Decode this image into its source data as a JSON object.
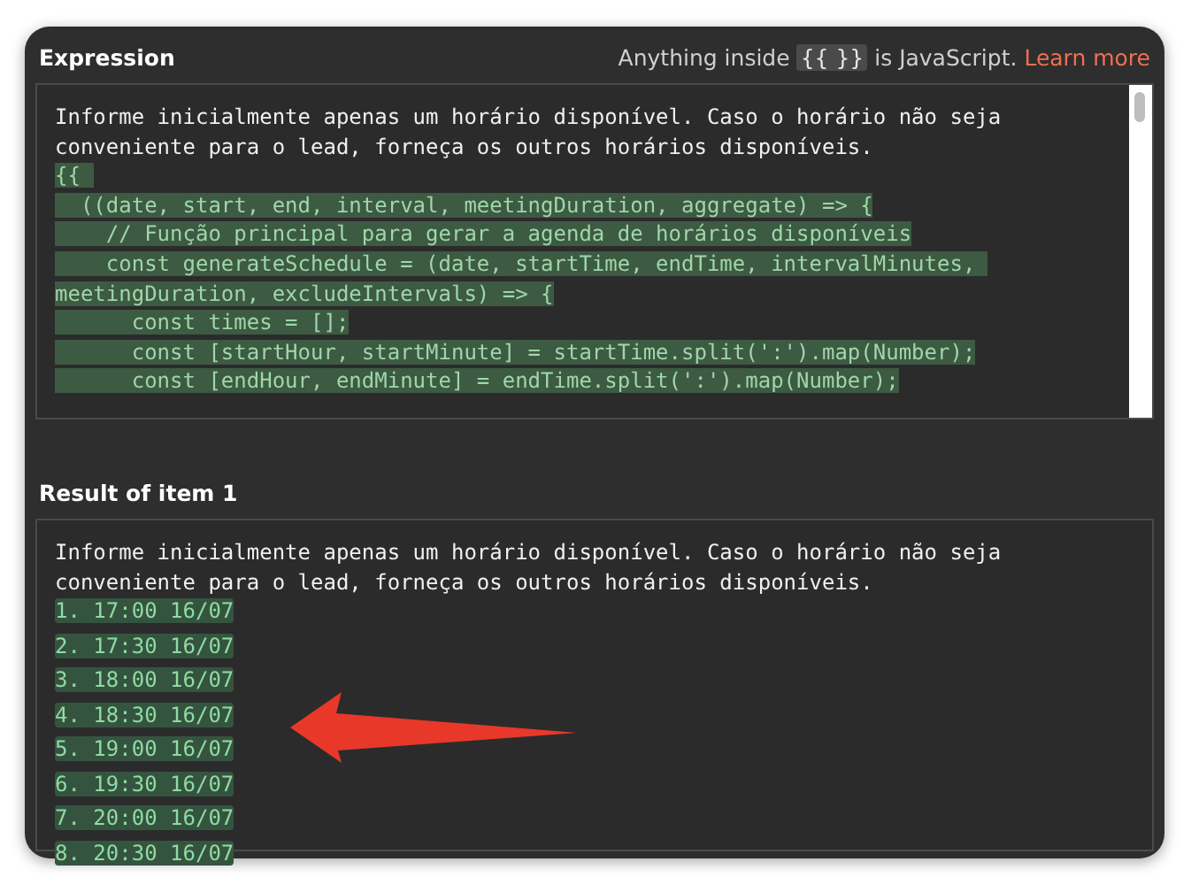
{
  "expression": {
    "title": "Expression",
    "hint_before": "Anything inside",
    "hint_code": "{{ }}",
    "hint_after": "is JavaScript.",
    "link": "Learn more",
    "lines": [
      {
        "text": "Informe inicialmente apenas um horário disponível. Caso o horário não seja",
        "kind": "plain"
      },
      {
        "text": "conveniente para o lead, forneça os outros horários disponíveis.",
        "kind": "plain"
      },
      {
        "text": "{{ ",
        "kind": "code"
      },
      {
        "text": "  ((date, start, end, interval, meetingDuration, aggregate) => {",
        "kind": "code"
      },
      {
        "text": "    // Função principal para gerar a agenda de horários disponíveis",
        "kind": "code"
      },
      {
        "text": "    const generateSchedule = (date, startTime, endTime, intervalMinutes, ",
        "kind": "code"
      },
      {
        "text": "meetingDuration, excludeIntervals) => {",
        "kind": "code"
      },
      {
        "text": "      const times = [];",
        "kind": "code"
      },
      {
        "text": "      const [startHour, startMinute] = startTime.split(':').map(Number);",
        "kind": "code"
      },
      {
        "text": "      const [endHour, endMinute] = endTime.split(':').map(Number);",
        "kind": "code"
      }
    ]
  },
  "result": {
    "title": "Result of item 1",
    "lines": [
      {
        "text": "Informe inicialmente apenas um horário disponível. Caso o horário não seja",
        "kind": "plain"
      },
      {
        "text": "conveniente para o lead, forneça os outros horários disponíveis.",
        "kind": "plain"
      },
      {
        "text": "1. 17:00 16/07",
        "kind": "value"
      },
      {
        "text": "2. 17:30 16/07",
        "kind": "value"
      },
      {
        "text": "3. 18:00 16/07",
        "kind": "value"
      },
      {
        "text": "4. 18:30 16/07",
        "kind": "value"
      },
      {
        "text": "5. 19:00 16/07",
        "kind": "value"
      },
      {
        "text": "6. 19:30 16/07",
        "kind": "value"
      },
      {
        "text": "7. 20:00 16/07",
        "kind": "value"
      },
      {
        "text": "8. 20:30 16/07",
        "kind": "value"
      }
    ]
  }
}
